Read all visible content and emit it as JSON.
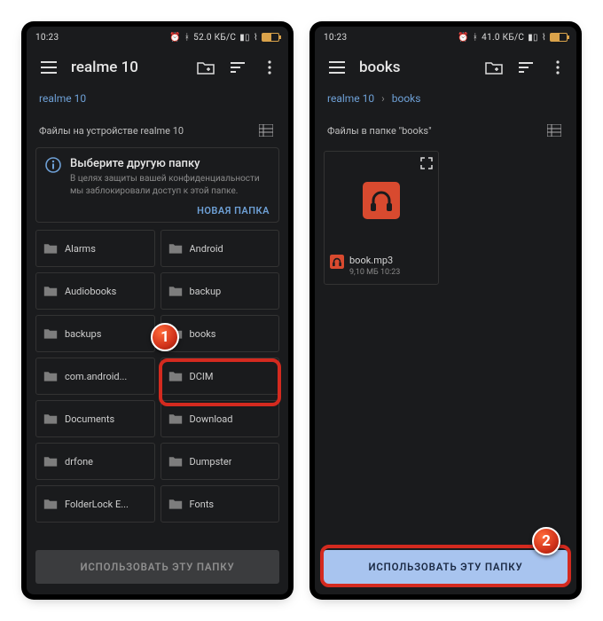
{
  "status": {
    "time": "10:23",
    "net_label": "52.0 КБ/С",
    "net_label2": "41.0 КБ/С",
    "battery": "50"
  },
  "left": {
    "title": "realme 10",
    "crumbs": [
      "realme 10"
    ],
    "section": "Файлы на устройстве realme 10",
    "notice": {
      "title": "Выберите другую папку",
      "body": "В целях защиты вашей конфиденциальности мы заблокировали доступ к этой папке.",
      "action": "НОВАЯ ПАПКА"
    },
    "folders": [
      "Alarms",
      "Android",
      "Audiobooks",
      "backup",
      "backups",
      "books",
      "com.android...",
      "DCIM",
      "Documents",
      "Download",
      "drfone",
      "Dumpster",
      "FolderLock E...",
      "Fonts"
    ],
    "button": "ИСПОЛЬЗОВАТЬ ЭТУ ПАПКУ"
  },
  "right": {
    "title": "books",
    "crumbs": [
      "realme 10",
      "books"
    ],
    "section": "Файлы в папке \"books\"",
    "file": {
      "name": "book.mp3",
      "meta": "9,10 МБ 10:23"
    },
    "button": "ИСПОЛЬЗОВАТЬ ЭТУ ПАПКУ"
  },
  "callouts": {
    "one": "1",
    "two": "2"
  }
}
